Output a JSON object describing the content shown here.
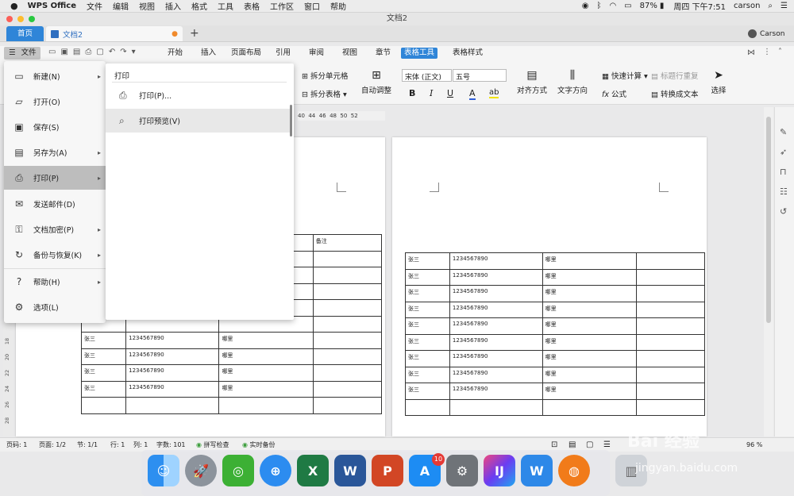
{
  "mac_menubar": {
    "apple": "",
    "app": "WPS Office",
    "items": [
      "文件",
      "编辑",
      "视图",
      "插入",
      "格式",
      "工具",
      "表格",
      "工作区",
      "窗口",
      "帮助"
    ],
    "battery": "87%",
    "clock": "周四 下午7:51",
    "user": "carson"
  },
  "window": {
    "title": "文档2"
  },
  "tabs": {
    "home": "首页",
    "doc": "文档2",
    "add": "+",
    "account": "Carson"
  },
  "ribbon": {
    "file_label": "文件",
    "tabs": [
      "开始",
      "插入",
      "页面布局",
      "引用",
      "审阅",
      "视图",
      "章节",
      "表格工具",
      "表格样式"
    ],
    "active_tab": "表格工具"
  },
  "toolbar": {
    "split_cell": "拆分单元格",
    "split_table": "拆分表格",
    "autofit": "自动调整",
    "font_name": "宋体 (正文)",
    "font_size": "五号",
    "align": "对齐方式",
    "text_dir": "文字方向",
    "quick_calc": "快速计算",
    "repeat_header": "标题行重复",
    "formula": "公式",
    "to_text": "转换成文本",
    "select": "选择",
    "bold": "B",
    "italic": "I",
    "underline": "U",
    "font_color": "A"
  },
  "ruler": {
    "marks": "40  44  46  48  50  52"
  },
  "vruler": {
    "marks": [
      "18",
      "20",
      "22",
      "24",
      "26",
      "28"
    ]
  },
  "file_menu": {
    "items": [
      {
        "label": "新建(N)",
        "arrow": "▸"
      },
      {
        "label": "打开(O)",
        "arrow": ""
      },
      {
        "label": "保存(S)",
        "arrow": ""
      },
      {
        "label": "另存为(A)",
        "arrow": "▸"
      },
      {
        "label": "打印(P)",
        "arrow": "▸"
      },
      {
        "label": "发送邮件(D)",
        "arrow": ""
      },
      {
        "label": "文档加密(P)",
        "arrow": "▸"
      },
      {
        "label": "备份与恢复(K)",
        "arrow": "▸"
      },
      {
        "label": "帮助(H)",
        "arrow": "▸"
      },
      {
        "label": "选项(L)",
        "arrow": ""
      }
    ],
    "selected_index": 4
  },
  "print_submenu": {
    "title": "打印",
    "items": [
      "打印(P)...",
      "打印预览(V)"
    ],
    "selected_index": 1
  },
  "page1_table": {
    "header_note": "备注",
    "rows": [
      [
        "张三",
        "1234567890",
        "哪里",
        ""
      ],
      [
        "张三",
        "1234567890",
        "哪里",
        ""
      ],
      [
        "张三",
        "1234567890",
        "哪里",
        ""
      ],
      [
        "张三",
        "1234567890",
        "哪里",
        ""
      ],
      [
        "",
        "",
        "",
        ""
      ]
    ]
  },
  "page2_table": {
    "rows": [
      [
        "张三",
        "1234567890",
        "哪里",
        ""
      ],
      [
        "张三",
        "1234567890",
        "哪里",
        ""
      ],
      [
        "张三",
        "1234567890",
        "哪里",
        ""
      ],
      [
        "张三",
        "1234567890",
        "哪里",
        ""
      ],
      [
        "张三",
        "1234567890",
        "哪里",
        ""
      ],
      [
        "张三",
        "1234567890",
        "哪里",
        ""
      ],
      [
        "张三",
        "1234567890",
        "哪里",
        ""
      ],
      [
        "张三",
        "1234567890",
        "哪里",
        ""
      ],
      [
        "张三",
        "1234567890",
        "哪里",
        ""
      ],
      [
        "",
        "",
        "",
        ""
      ]
    ]
  },
  "status": {
    "pagenum": "页码: 1",
    "pages": "页面: 1/2",
    "section": "节: 1/1",
    "row": "行: 1",
    "col": "列: 1",
    "words": "字数: 101",
    "spell": "拼写检查",
    "backup": "实时备份",
    "zoom": "96 %"
  },
  "dock": {
    "badge": "10"
  },
  "watermark": {
    "text": "Bai 经验",
    "url": "jingyan.baidu.com"
  }
}
